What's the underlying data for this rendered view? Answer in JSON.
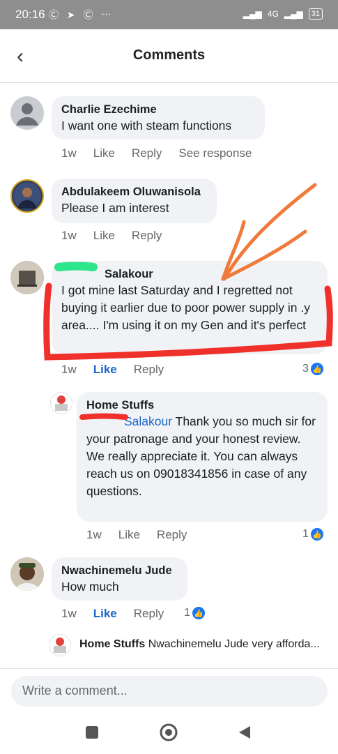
{
  "status": {
    "time": "20:16",
    "left_icons": "Ⓒ ➤ Ⓒ ⋯",
    "signal": "4G",
    "battery": "31"
  },
  "header": {
    "title": "Comments",
    "back_icon": "chevron-left-icon"
  },
  "comments": [
    {
      "name": "Charlie Ezechime",
      "text": "I want one with steam functions",
      "time": "1w",
      "like": "Like",
      "reply": "Reply",
      "extra": "See response"
    },
    {
      "name": "Abdulakeem Oluwanisola",
      "text": "Please I am interest",
      "time": "1w",
      "like": "Like",
      "reply": "Reply"
    },
    {
      "name": "Salakour",
      "text": "I got mine last Saturday and I regretted not buying it earlier due to poor power supply in .y area.... I'm using it on my Gen and it's perfect",
      "time": "1w",
      "like": "Like",
      "reply": "Reply",
      "reactions": "3"
    },
    {
      "name": "Home Stuffs",
      "mention": "Salakour",
      "text": " Thank you so much sir for your patronage and your honest review. We really appreciate it. You can always reach us on 09018341856 in case of any questions.",
      "time": "1w",
      "like": "Like",
      "reply": "Reply",
      "reactions": "1"
    },
    {
      "name": "Nwachinemelu Jude",
      "text": "How much",
      "time": "1w",
      "like": "Like",
      "reply": "Reply",
      "reactions": "1"
    }
  ],
  "reply_preview": {
    "name": "Home Stuffs",
    "text": "Nwachinemelu Jude very afforda..."
  },
  "composer": {
    "placeholder": "Write a comment..."
  },
  "colors": {
    "accent": "#1b66c9",
    "bubble": "#f0f2f5",
    "annotation_red": "#f0302a",
    "annotation_orange": "#f07a3a"
  }
}
